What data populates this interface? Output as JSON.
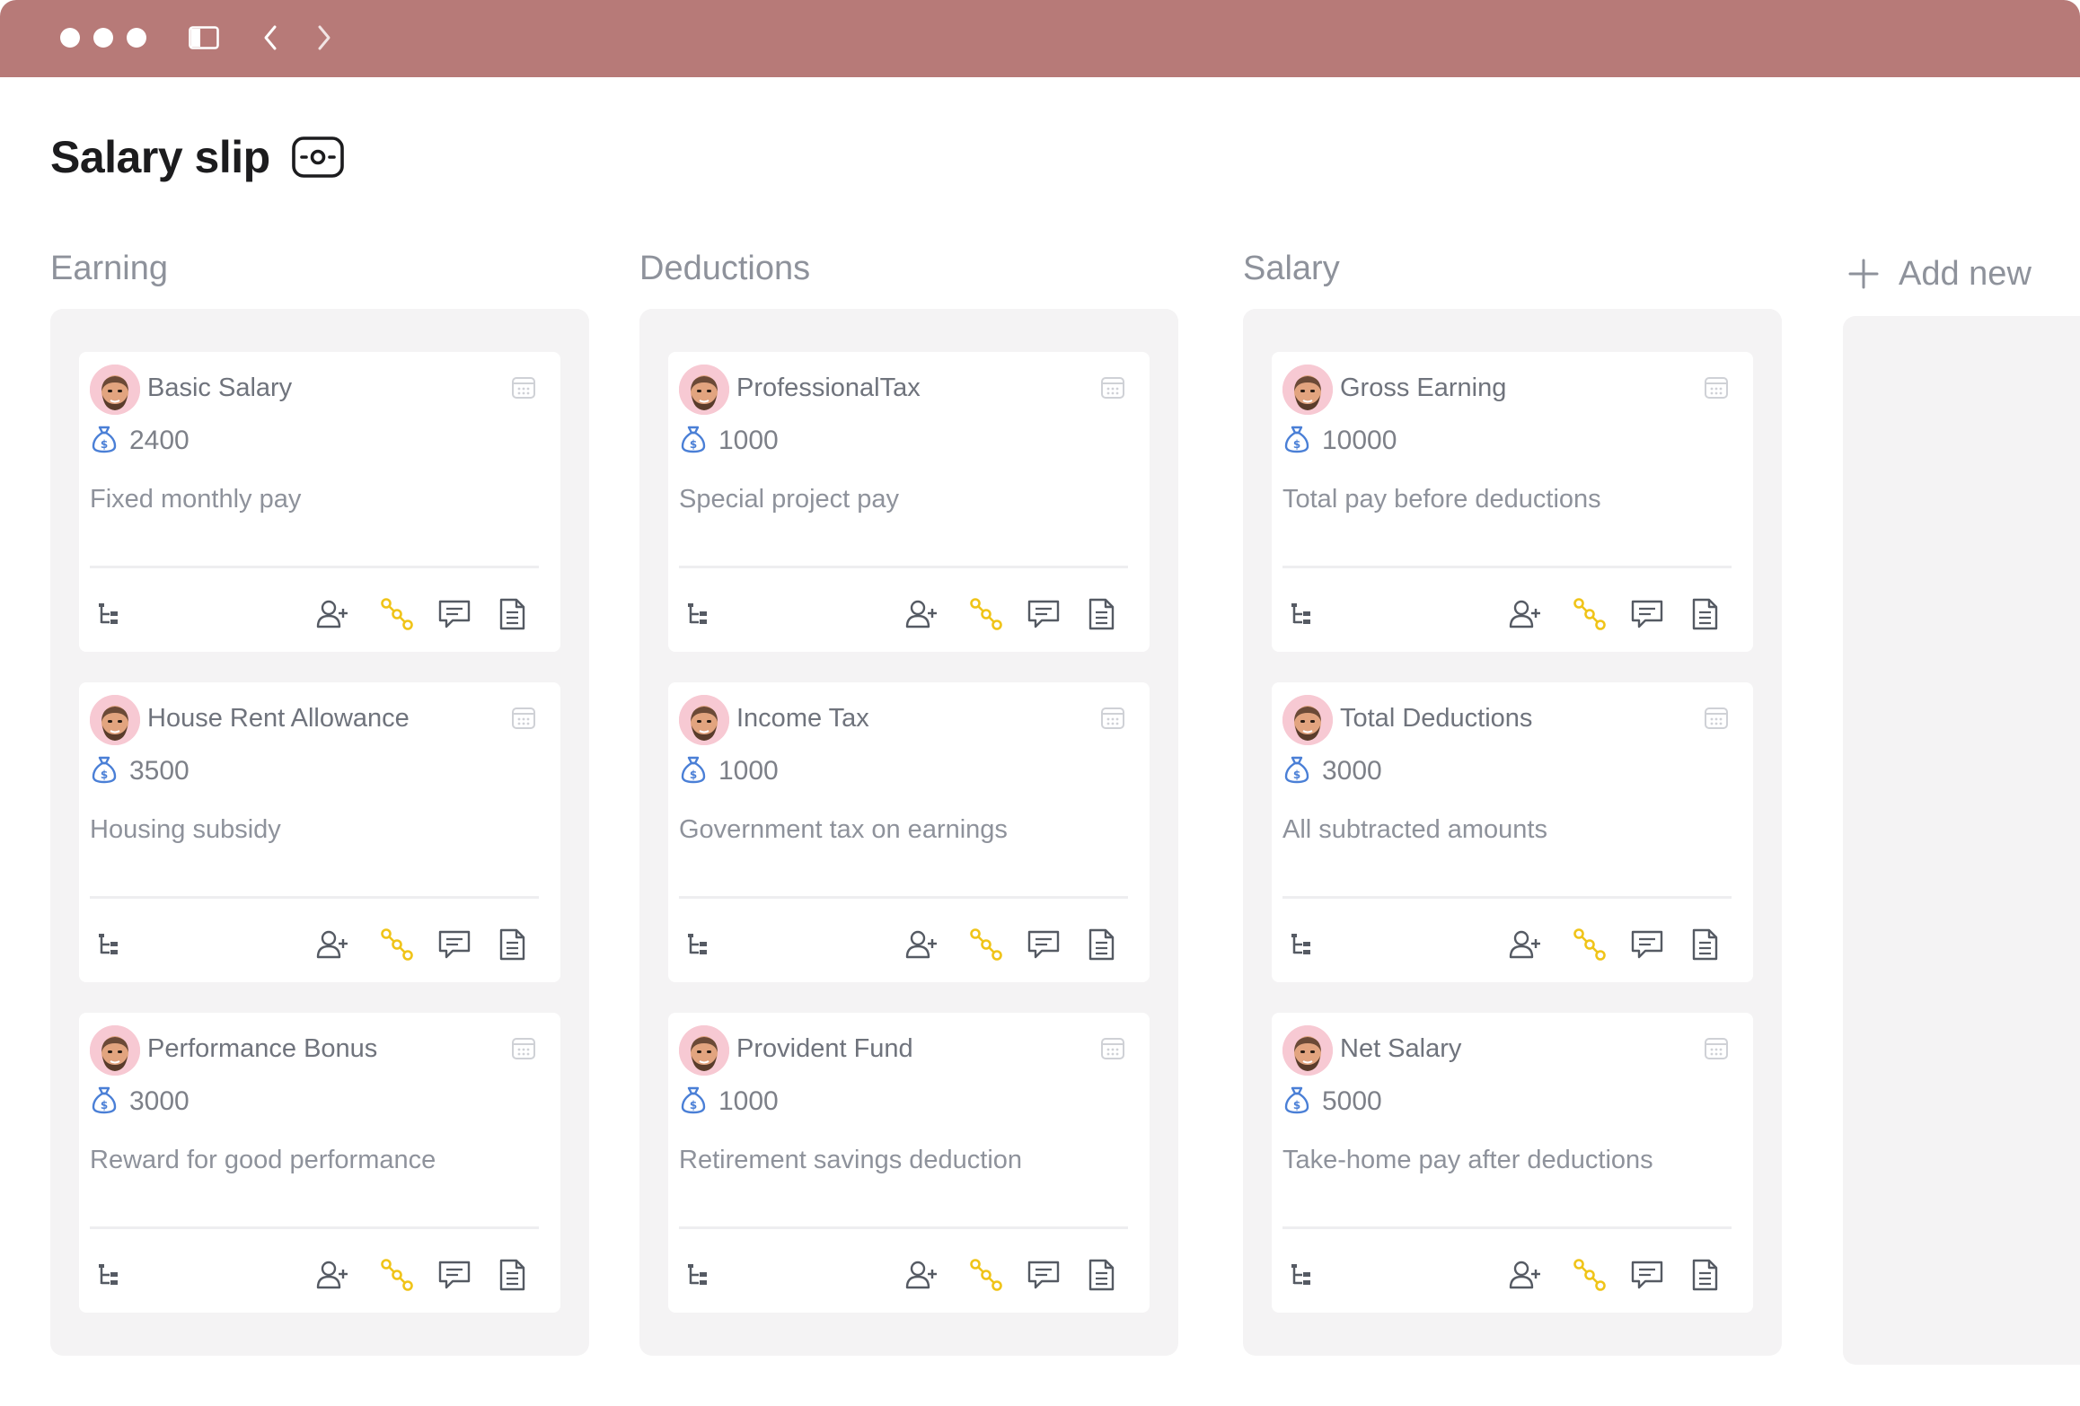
{
  "page": {
    "title": "Salary slip"
  },
  "toolbar": {
    "icons": [
      "traffic-light",
      "sidebar-icon",
      "chevron-left-icon",
      "chevron-right-icon"
    ]
  },
  "add_new_label": "Add new",
  "colors": {
    "titlebar": "#b77a78",
    "column_bg": "#f4f3f4",
    "accent_blue": "#4a7fd6",
    "accent_yellow": "#f0c419",
    "avatar_bg": "#f7c9d3"
  },
  "columns": [
    {
      "title": "Earning",
      "cards": [
        {
          "title": "Basic Salary",
          "amount": "2400",
          "description": "Fixed monthly pay"
        },
        {
          "title": "House Rent Allowance",
          "amount": "3500",
          "description": "Housing subsidy"
        },
        {
          "title": "Performance Bonus",
          "amount": "3000",
          "description": "Reward for good performance"
        }
      ]
    },
    {
      "title": "Deductions",
      "cards": [
        {
          "title": "ProfessionalTax",
          "amount": "1000",
          "description": "Special project pay"
        },
        {
          "title": "Income Tax",
          "amount": "1000",
          "description": "Government tax on earnings"
        },
        {
          "title": "Provident Fund",
          "amount": "1000",
          "description": "Retirement savings deduction"
        }
      ]
    },
    {
      "title": "Salary",
      "cards": [
        {
          "title": "Gross Earning",
          "amount": "10000",
          "description": "Total pay before deductions"
        },
        {
          "title": "Total Deductions",
          "amount": "3000",
          "description": "All subtracted amounts"
        },
        {
          "title": "Net Salary",
          "amount": "5000",
          "description": "Take-home pay after deductions"
        }
      ]
    }
  ]
}
